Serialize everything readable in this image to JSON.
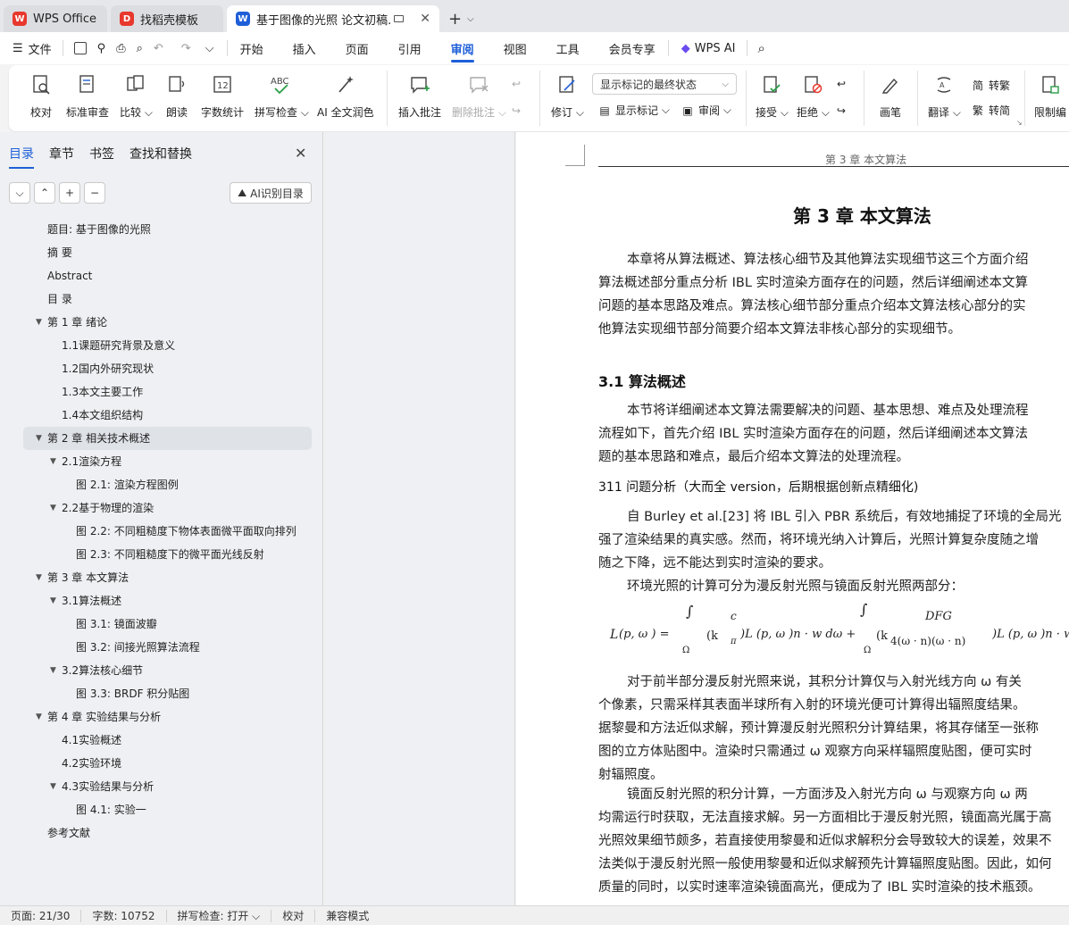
{
  "tabs": [
    {
      "label": "WPS Office",
      "icon": "wps-logo-icon",
      "color": "#e8382d"
    },
    {
      "label": "找稻壳模板",
      "icon": "docer-logo-icon",
      "color": "#e8382d"
    },
    {
      "label": "基于图像的光照 论文初稿.do",
      "icon": "word-doc-icon",
      "color": "#1e5fd8"
    }
  ],
  "menu": {
    "file": "文件",
    "items": [
      "开始",
      "插入",
      "页面",
      "引用",
      "审阅",
      "视图",
      "工具",
      "会员专享"
    ],
    "active": "审阅",
    "ai": "WPS AI"
  },
  "ribbon": {
    "proof": "校对",
    "standard_review": "标准审查",
    "compare": "比较",
    "read_aloud": "朗读",
    "word_count": "字数统计",
    "spell_check": "拼写检查",
    "ai_polish": "AI 全文润色",
    "insert_comment": "插入批注",
    "delete_comment": "删除批注",
    "revise": "修订",
    "display_mode": "显示标记的最终状态",
    "show_markup": "显示标记",
    "review_pane": "审阅",
    "accept": "接受",
    "reject": "拒绝",
    "pen": "画笔",
    "translate": "翻译",
    "to_traditional": "转繁",
    "to_simplified": "转简",
    "restrict_edit": "限制编"
  },
  "nav": {
    "tabs": [
      "目录",
      "章节",
      "书签",
      "查找和替换"
    ],
    "active_tab": "目录",
    "ai_toc": "AI识别目录",
    "toc": [
      {
        "text": "题目:  基于图像的光照",
        "level": 0,
        "arrow": ""
      },
      {
        "text": "摘 要",
        "level": 0,
        "arrow": ""
      },
      {
        "text": "Abstract",
        "level": 0,
        "arrow": ""
      },
      {
        "text": "目 录",
        "level": 0,
        "arrow": ""
      },
      {
        "text": "第 1 章  绪论",
        "level": 0,
        "arrow": "▼"
      },
      {
        "text": "1.1课题研究背景及意义",
        "level": 1,
        "arrow": ""
      },
      {
        "text": "1.2国内外研究现状",
        "level": 1,
        "arrow": ""
      },
      {
        "text": "1.3本文主要工作",
        "level": 1,
        "arrow": ""
      },
      {
        "text": "1.4本文组织结构",
        "level": 1,
        "arrow": ""
      },
      {
        "text": "第 2 章  相关技术概述",
        "level": 0,
        "arrow": "▼",
        "selected": true
      },
      {
        "text": "2.1渲染方程",
        "level": 1,
        "arrow": "▼"
      },
      {
        "text": "图 2.1: 渲染方程图例",
        "level": 2,
        "arrow": ""
      },
      {
        "text": "2.2基于物理的渲染",
        "level": 1,
        "arrow": "▼"
      },
      {
        "text": "图 2.2: 不同粗糙度下物体表面微平面取向排列",
        "level": 2,
        "arrow": ""
      },
      {
        "text": "图 2.3: 不同粗糙度下的微平面光线反射",
        "level": 2,
        "arrow": ""
      },
      {
        "text": "第 3 章  本文算法",
        "level": 0,
        "arrow": "▼"
      },
      {
        "text": "3.1算法概述",
        "level": 1,
        "arrow": "▼"
      },
      {
        "text": "图 3.1: 镜面波瓣",
        "level": 2,
        "arrow": ""
      },
      {
        "text": "图 3.2: 间接光照算法流程",
        "level": 2,
        "arrow": ""
      },
      {
        "text": "3.2算法核心细节",
        "level": 1,
        "arrow": "▼"
      },
      {
        "text": "图 3.3: BRDF 积分贴图",
        "level": 2,
        "arrow": ""
      },
      {
        "text": "第 4 章  实验结果与分析",
        "level": 0,
        "arrow": "▼"
      },
      {
        "text": "4.1实验概述",
        "level": 1,
        "arrow": ""
      },
      {
        "text": "4.2实验环境",
        "level": 1,
        "arrow": ""
      },
      {
        "text": "4.3实验结果与分析",
        "level": 1,
        "arrow": "▼"
      },
      {
        "text": "图 4.1: 实验一",
        "level": 2,
        "arrow": ""
      },
      {
        "text": "参考文献",
        "level": 0,
        "arrow": ""
      }
    ]
  },
  "doc": {
    "header": "第 3 章  本文算法",
    "chapter_title": "第 3 章    本文算法",
    "intro": [
      "本章将从算法概述、算法核心细节及其他算法实现细节这三个方面介绍",
      "算法概述部分重点分析  IBL 实时渲染方面存在的问题，然后详细阐述本文算",
      "问题的基本思路及难点。算法核心细节部分重点介绍本文算法核心部分的实",
      "他算法实现细节部分简要介绍本文算法非核心部分的实现细节。"
    ],
    "section_title": "3.1    算法概述",
    "section_para": [
      "本节将详细阐述本文算法需要解决的问题、基本思想、难点及处理流程",
      "流程如下，首先介绍  IBL 实时渲染方面存在的问题，然后详细阐述本文算法",
      "题的基本思路和难点，最后介绍本文算法的处理流程。"
    ],
    "subsection_title": "311        问题分析（大而全  version，后期根据创新点精细化)",
    "sub_para": [
      "自  Burley et al.[23] 将 IBL 引入 PBR 系统后，有效地捕捉了环境的全局光",
      "强了渲染结果的真实感。然而，将环境光纳入计算后，光照计算复杂度随之增",
      "随之下降，远不能达到实时渲染的要求。",
      "环境光照的计算可分为漫反射光照与镜面反射光照两部分："
    ],
    "formula": {
      "lhs": "L",
      "eq": "(p, ω  ) =",
      "int1": "∫",
      "int2": "∫",
      "omega1": "Ω",
      "omega2": "Ω",
      "c": "c",
      "kd": "(k",
      "pi": "π",
      "t1": ")L (p, ω )n · w dω +",
      "dfg": "DFG",
      "ks": "(k",
      "den": "4(ω  · n)(ω  · n)",
      "t2": ")L (p, ω )n · w"
    },
    "para_after": [
      "对于前半部分漫反射光照来说，其积分计算仅与入射光线方向   ω  有关",
      "个像素，只需采样其表面半球所有入射的环境光便可计算得出辐照度结果。",
      "据黎曼和方法近似求解，预计算漫反射光照积分计算结果，将其存储至一张称",
      "图的立方体贴图中。渲染时只需通过  ω   观察方向采样辐照度贴图，便可实时",
      "射辐照度。",
      "镜面反射光照的积分计算，一方面涉及入射光方向   ω  与观察方向  ω   两",
      "均需运行时获取，无法直接求解。另一方面相比于漫反射光照，镜面高光属于高",
      "光照效果细节颇多，若直接使用黎曼和近似求解积分会导致较大的误差，效果不",
      "法类似于漫反射光照一般使用黎曼和近似求解预先计算辐照度贴图。因此，如何",
      "质量的同时，以实时速率渲染镜面高光，便成为了  IBL 实时渲染的技术瓶颈。"
    ]
  },
  "status": {
    "page": "页面: 21/30",
    "words": "字数: 10752",
    "spell": "拼写检查: 打开",
    "proof": "校对",
    "compat": "兼容模式"
  }
}
